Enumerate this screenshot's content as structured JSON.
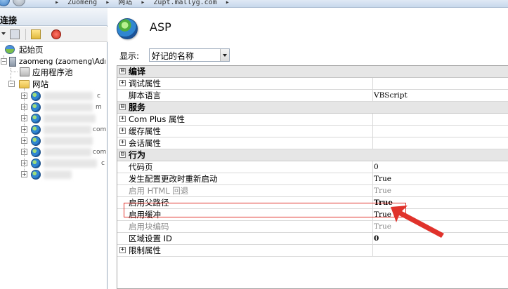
{
  "addressbar": {
    "breadcrumb": "▸  Zuomeng  ▸  网站  ▸  Zupt.mallyg.com  ▸"
  },
  "left_pane": {
    "title": "连接",
    "tree": {
      "start_page": "起始页",
      "server": "zaomeng (zaomeng\\Adm",
      "app_pools": "应用程序池",
      "sites_node": "网站",
      "sites": [
        {
          "label": "c"
        },
        {
          "label": "m"
        },
        {
          "label": ""
        },
        {
          "label": "com"
        },
        {
          "label": ""
        },
        {
          "label": "com"
        },
        {
          "label": "c"
        },
        {
          "label": ""
        },
        {
          "label": ""
        }
      ]
    }
  },
  "main": {
    "title": "ASP",
    "display_label": "显示:",
    "display_value": "好记的名称",
    "properties": [
      {
        "type": "category",
        "name": "编译",
        "expander": "⊟"
      },
      {
        "type": "prop",
        "name": "调试属性",
        "value": "",
        "expander": "+"
      },
      {
        "type": "prop",
        "name": "脚本语言",
        "value": "VBScript"
      },
      {
        "type": "category",
        "name": "服务",
        "expander": "⊟"
      },
      {
        "type": "prop",
        "name": "Com Plus 属性",
        "value": "",
        "expander": "+"
      },
      {
        "type": "prop",
        "name": "缓存属性",
        "value": "",
        "expander": "+"
      },
      {
        "type": "prop",
        "name": "会话属性",
        "value": "",
        "expander": "+"
      },
      {
        "type": "category",
        "name": "行为",
        "expander": "⊟"
      },
      {
        "type": "prop",
        "name": "代码页",
        "value": "0"
      },
      {
        "type": "prop",
        "name": "发生配置更改时重新启动",
        "value": "True"
      },
      {
        "type": "prop",
        "name": "启用 HTML 回退",
        "value": "True",
        "style": "gray"
      },
      {
        "type": "prop",
        "name": "启用父路径",
        "value": "True",
        "style": "bold"
      },
      {
        "type": "prop",
        "name": "启用缓冲",
        "value": "True"
      },
      {
        "type": "prop",
        "name": "启用块编码",
        "value": "True",
        "style": "gray"
      },
      {
        "type": "prop",
        "name": "区域设置 ID",
        "value": "0",
        "style": "bold"
      },
      {
        "type": "prop",
        "name": "限制属性",
        "value": "",
        "expander": "+"
      }
    ]
  },
  "colors": {
    "highlight": "#e0322b",
    "category_bg": "#e6e6e6",
    "pane_title_bg": "#dbe4ef"
  },
  "icons": [
    "back-icon",
    "forward-icon",
    "save-icon",
    "up-folder-icon",
    "delete-icon",
    "home-icon",
    "server-icon",
    "app-pool-icon",
    "folder-icon",
    "globe-icon",
    "asp-globe-icon",
    "dropdown-arrow-icon"
  ]
}
